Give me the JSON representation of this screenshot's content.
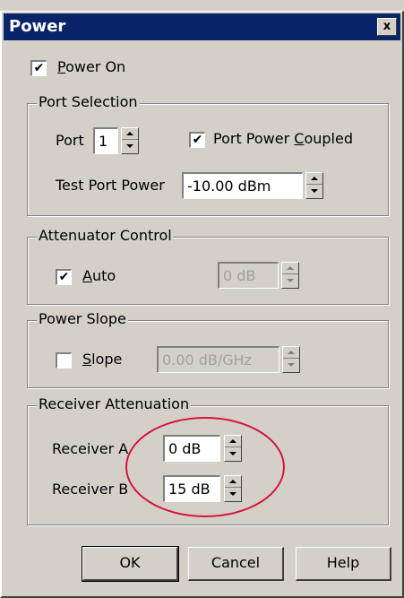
{
  "window": {
    "title": "Power",
    "close_label": "x"
  },
  "power_on": {
    "checked_glyph": "✔",
    "label_prefix": "",
    "label_mnemonic": "P",
    "label_rest": "ower On"
  },
  "port_selection": {
    "legend": "Port Selection",
    "port_label": "Port",
    "port_value": "1",
    "coupled_checked_glyph": "✔",
    "coupled_label_prefix": "Port Power ",
    "coupled_label_mnemonic": "C",
    "coupled_label_rest": "oupled",
    "test_port_power_label": "Test Port Power",
    "test_port_power_value": "-10.00 dBm"
  },
  "attenuator_control": {
    "legend": "Attenuator Control",
    "auto_checked_glyph": "✔",
    "auto_label_mnemonic": "A",
    "auto_label_rest": "uto",
    "value": "0 dB"
  },
  "power_slope": {
    "legend": "Power Slope",
    "slope_checked_glyph": "",
    "slope_label_mnemonic": "S",
    "slope_label_rest": "lope",
    "value": "0.00 dB/GHz"
  },
  "receiver_attenuation": {
    "legend": "Receiver Attenuation",
    "receiver_a_label": "Receiver A",
    "receiver_a_value": "0 dB",
    "receiver_b_label": "Receiver B",
    "receiver_b_value": "15 dB"
  },
  "buttons": {
    "ok": "OK",
    "cancel": "Cancel",
    "help": "Help"
  },
  "annotation": {
    "ellipse_color": "#d6123e"
  }
}
